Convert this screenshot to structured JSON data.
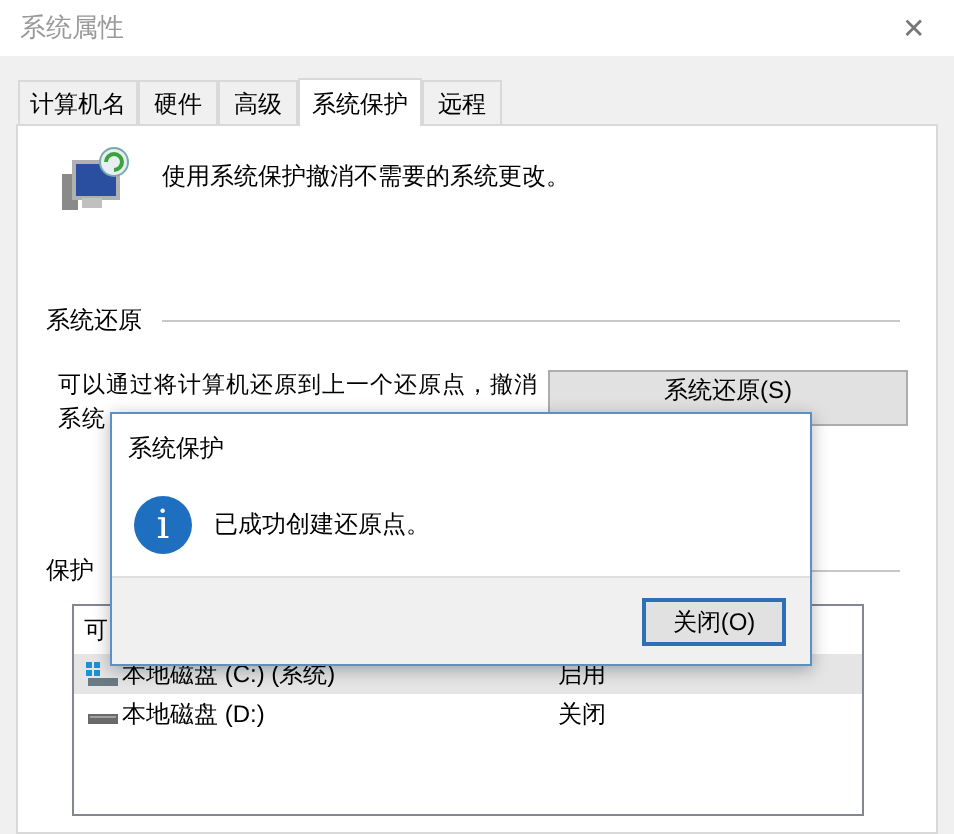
{
  "window": {
    "title": "系统属性",
    "close": "✕"
  },
  "tabs": [
    {
      "label": "计算机名",
      "selected": false
    },
    {
      "label": "硬件",
      "selected": false
    },
    {
      "label": "高级",
      "selected": false
    },
    {
      "label": "系统保护",
      "selected": true
    },
    {
      "label": "远程",
      "selected": false
    }
  ],
  "intro": "使用系统保护撤消不需要的系统更改。",
  "restore_section": {
    "heading": "系统还原",
    "paragraph_lines": [
      "可以通过将计算机还原到上一个还原点，撤消",
      "系统"
    ],
    "button": "系统还原(S)"
  },
  "protection_section": {
    "heading": "保护",
    "columns": [
      "可"
    ],
    "rows": [
      {
        "kind": "system",
        "name": "本地磁盘 (C:) (系统)",
        "status": "启用",
        "selected": true
      },
      {
        "kind": "plain",
        "name": "本地磁盘 (D:)",
        "status": "关闭",
        "selected": false
      }
    ]
  },
  "dialog": {
    "title": "系统保护",
    "message": "已成功创建还原点。",
    "icon": "i",
    "button": "关闭(O)"
  }
}
